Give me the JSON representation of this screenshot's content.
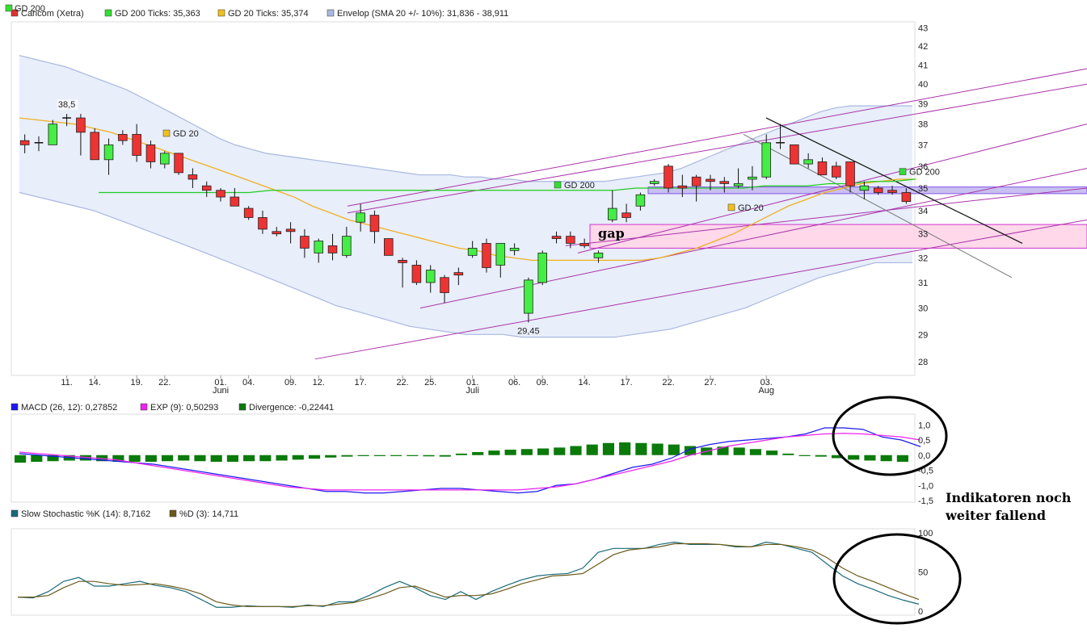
{
  "chart_data": [
    {
      "type": "candlestick",
      "legend": [
        {
          "label": "Cancom (Xetra)",
          "color": "#e03030"
        },
        {
          "label": "GD 200 Ticks: 35,363",
          "color": "#33dd33"
        },
        {
          "label": "GD 20 Ticks: 35,374",
          "color": "#f0c020"
        },
        {
          "label": "Envelop (SMA 20 +/- 10%): 31,836 - 38,911",
          "color": "#a8b8e0"
        }
      ],
      "legend_overlap_label": "GD 200",
      "y_ticks": [
        28,
        29,
        30,
        31,
        32,
        33,
        34,
        35,
        36,
        37,
        38,
        39,
        40,
        41,
        42,
        43
      ],
      "ylim": [
        27.6,
        43.2
      ],
      "y_scale": "log",
      "x_ticks": [
        "11.",
        "14.",
        "19.",
        "22.",
        "01.",
        "04.",
        "09.",
        "12.",
        "17.",
        "22.",
        "25.",
        "01.",
        "06.",
        "09.",
        "14.",
        "17.",
        "22.",
        "27.",
        "03."
      ],
      "x_tick_index": [
        3,
        5,
        8,
        10,
        14,
        16,
        19,
        21,
        24,
        27,
        29,
        32,
        35,
        37,
        40,
        43,
        46,
        49,
        53
      ],
      "month_labels": [
        {
          "text": "Juni",
          "index": 14
        },
        {
          "text": "Juli",
          "index": 32
        },
        {
          "text": "Aug",
          "index": 53
        }
      ],
      "candles": [
        {
          "o": 37.2,
          "h": 37.5,
          "l": 36.6,
          "c": 37.0
        },
        {
          "o": 37.1,
          "h": 37.4,
          "l": 36.7,
          "c": 37.1
        },
        {
          "o": 37.0,
          "h": 38.2,
          "l": 37.0,
          "c": 38.0
        },
        {
          "o": 38.3,
          "h": 38.5,
          "l": 37.9,
          "c": 38.3
        },
        {
          "o": 38.3,
          "h": 38.5,
          "l": 36.5,
          "c": 37.6
        },
        {
          "o": 37.6,
          "h": 37.8,
          "l": 36.3,
          "c": 36.3
        },
        {
          "o": 36.3,
          "h": 37.3,
          "l": 35.6,
          "c": 37.0
        },
        {
          "o": 37.5,
          "h": 37.7,
          "l": 37.0,
          "c": 37.2
        },
        {
          "o": 37.5,
          "h": 38.0,
          "l": 36.2,
          "c": 36.5
        },
        {
          "o": 37.0,
          "h": 37.2,
          "l": 35.9,
          "c": 36.2
        },
        {
          "o": 36.1,
          "h": 36.7,
          "l": 35.9,
          "c": 36.6
        },
        {
          "o": 36.6,
          "h": 36.6,
          "l": 35.6,
          "c": 35.7
        },
        {
          "o": 35.6,
          "h": 35.9,
          "l": 35.0,
          "c": 35.4
        },
        {
          "o": 35.1,
          "h": 35.3,
          "l": 34.6,
          "c": 34.9
        },
        {
          "o": 34.9,
          "h": 35.0,
          "l": 34.4,
          "c": 34.6
        },
        {
          "o": 34.6,
          "h": 35.0,
          "l": 34.2,
          "c": 34.2
        },
        {
          "o": 34.1,
          "h": 34.2,
          "l": 33.6,
          "c": 33.7
        },
        {
          "o": 33.7,
          "h": 34.0,
          "l": 33.0,
          "c": 33.2
        },
        {
          "o": 33.1,
          "h": 33.3,
          "l": 32.9,
          "c": 33.0
        },
        {
          "o": 33.2,
          "h": 33.5,
          "l": 32.6,
          "c": 33.1
        },
        {
          "o": 32.9,
          "h": 33.2,
          "l": 32.0,
          "c": 32.4
        },
        {
          "o": 32.2,
          "h": 32.8,
          "l": 31.8,
          "c": 32.7
        },
        {
          "o": 32.5,
          "h": 33.0,
          "l": 31.9,
          "c": 32.2
        },
        {
          "o": 32.1,
          "h": 33.3,
          "l": 32.0,
          "c": 32.9
        },
        {
          "o": 33.5,
          "h": 34.3,
          "l": 33.1,
          "c": 33.9
        },
        {
          "o": 33.8,
          "h": 34.0,
          "l": 32.6,
          "c": 33.1
        },
        {
          "o": 32.8,
          "h": 32.8,
          "l": 32.1,
          "c": 32.1
        },
        {
          "o": 31.9,
          "h": 32.0,
          "l": 30.8,
          "c": 31.8
        },
        {
          "o": 31.7,
          "h": 31.9,
          "l": 30.9,
          "c": 31.0
        },
        {
          "o": 31.0,
          "h": 31.7,
          "l": 30.6,
          "c": 31.5
        },
        {
          "o": 31.2,
          "h": 31.3,
          "l": 30.2,
          "c": 30.6
        },
        {
          "o": 31.4,
          "h": 31.6,
          "l": 30.9,
          "c": 31.3
        },
        {
          "o": 32.1,
          "h": 32.7,
          "l": 32.0,
          "c": 32.4
        },
        {
          "o": 32.6,
          "h": 32.8,
          "l": 31.4,
          "c": 31.6
        },
        {
          "o": 31.7,
          "h": 32.6,
          "l": 31.2,
          "c": 32.6
        },
        {
          "o": 32.3,
          "h": 32.6,
          "l": 32.1,
          "c": 32.4
        },
        {
          "o": 29.8,
          "h": 31.2,
          "l": 29.45,
          "c": 31.1
        },
        {
          "o": 31.0,
          "h": 32.3,
          "l": 30.9,
          "c": 32.2
        },
        {
          "o": 32.9,
          "h": 33.1,
          "l": 32.6,
          "c": 32.8
        },
        {
          "o": 32.9,
          "h": 33.1,
          "l": 32.4,
          "c": 32.6
        },
        {
          "o": 32.6,
          "h": 32.8,
          "l": 32.4,
          "c": 32.5
        },
        {
          "o": 32.0,
          "h": 32.3,
          "l": 31.8,
          "c": 32.2
        },
        {
          "o": 33.6,
          "h": 34.9,
          "l": 33.5,
          "c": 34.1
        },
        {
          "o": 33.9,
          "h": 34.3,
          "l": 33.5,
          "c": 33.7
        },
        {
          "o": 34.2,
          "h": 34.8,
          "l": 34.0,
          "c": 34.7
        },
        {
          "o": 35.2,
          "h": 35.4,
          "l": 35.1,
          "c": 35.3
        },
        {
          "o": 36.0,
          "h": 36.1,
          "l": 34.8,
          "c": 35.0
        },
        {
          "o": 35.1,
          "h": 35.6,
          "l": 34.6,
          "c": 35.0
        },
        {
          "o": 35.5,
          "h": 35.6,
          "l": 34.4,
          "c": 35.1
        },
        {
          "o": 35.4,
          "h": 35.6,
          "l": 34.9,
          "c": 35.3
        },
        {
          "o": 35.3,
          "h": 35.5,
          "l": 34.8,
          "c": 35.2
        },
        {
          "o": 35.1,
          "h": 35.9,
          "l": 35.0,
          "c": 35.2
        },
        {
          "o": 35.4,
          "h": 36.0,
          "l": 34.9,
          "c": 35.5
        },
        {
          "o": 35.5,
          "h": 37.5,
          "l": 35.4,
          "c": 37.1
        },
        {
          "o": 37.1,
          "h": 38.0,
          "l": 36.8,
          "c": 37.1
        },
        {
          "o": 37.0,
          "h": 37.0,
          "l": 36.1,
          "c": 36.1
        },
        {
          "o": 36.1,
          "h": 36.6,
          "l": 35.9,
          "c": 36.3
        },
        {
          "o": 36.2,
          "h": 36.4,
          "l": 35.6,
          "c": 35.6
        },
        {
          "o": 36.0,
          "h": 36.2,
          "l": 35.4,
          "c": 35.5
        },
        {
          "o": 36.2,
          "h": 36.2,
          "l": 34.8,
          "c": 35.1
        },
        {
          "o": 34.9,
          "h": 35.3,
          "l": 34.5,
          "c": 35.1
        },
        {
          "o": 35.0,
          "h": 35.1,
          "l": 34.7,
          "c": 34.8
        },
        {
          "o": 34.9,
          "h": 35.1,
          "l": 34.7,
          "c": 34.8
        },
        {
          "o": 34.8,
          "h": 35.0,
          "l": 34.3,
          "c": 34.4
        }
      ],
      "envelope_upper": [
        41.5,
        41.3,
        41.1,
        40.9,
        40.6,
        40.3,
        40.0,
        39.7,
        39.3,
        38.9,
        38.5,
        38.1,
        37.7,
        37.3,
        37.0,
        36.8,
        36.6,
        36.5,
        36.4,
        36.3,
        36.2,
        36.1,
        36.0,
        35.9,
        35.8,
        35.7,
        35.6,
        35.6,
        35.6,
        35.5,
        35.5,
        35.4,
        35.4,
        35.3,
        35.3,
        35.3,
        35.3,
        35.3,
        35.3,
        35.4,
        35.5,
        35.6,
        35.7,
        35.9,
        36.2,
        36.5,
        36.8,
        37.1,
        37.4,
        37.7,
        38.0,
        38.3,
        38.6,
        38.8,
        38.9,
        38.9,
        38.9,
        38.9,
        38.9
      ],
      "envelope_lower": [
        34.8,
        34.6,
        34.4,
        34.2,
        34.0,
        33.7,
        33.4,
        33.1,
        32.8,
        32.5,
        32.2,
        31.9,
        31.6,
        31.3,
        31.0,
        30.7,
        30.4,
        30.1,
        29.9,
        29.7,
        29.5,
        29.3,
        29.2,
        29.1,
        29.0,
        29.0,
        29.0,
        28.9,
        28.9,
        28.9,
        28.9,
        28.9,
        28.9,
        29.0,
        29.1,
        29.2,
        29.4,
        29.6,
        29.8,
        30.0,
        30.3,
        30.6,
        30.9,
        31.2,
        31.4,
        31.6,
        31.8,
        31.8,
        31.8
      ],
      "gd20": [
        38.3,
        38.2,
        38.1,
        38.0,
        37.8,
        37.6,
        37.3,
        37.0,
        36.7,
        36.4,
        36.1,
        35.8,
        35.5,
        35.2,
        34.9,
        34.6,
        34.2,
        33.9,
        33.6,
        33.4,
        33.2,
        33.0,
        32.8,
        32.6,
        32.4,
        32.3,
        32.1,
        32.0,
        31.9,
        31.9,
        31.9,
        31.9,
        31.9,
        31.9,
        31.9,
        32.0,
        32.2,
        32.4,
        32.7,
        33.0,
        33.4,
        33.8,
        34.2,
        34.5,
        34.8,
        35.0,
        35.2,
        35.3,
        35.4,
        35.4
      ],
      "gd200": [
        34.8,
        34.8,
        34.8,
        34.8,
        34.8,
        34.8,
        34.8,
        34.8,
        34.9,
        34.9,
        34.9,
        34.9,
        34.9,
        34.9,
        34.9,
        34.9,
        34.9,
        34.9,
        34.9,
        34.9,
        34.9,
        34.9,
        34.9,
        34.9,
        34.9,
        35.0,
        35.0,
        35.0,
        35.0,
        35.0,
        35.0,
        35.1,
        35.1,
        35.1,
        35.2,
        35.2,
        35.3,
        35.3,
        35.4
      ],
      "point_labels": [
        {
          "text": "38,5"
        },
        {
          "text": "29,45"
        }
      ],
      "markers": [
        {
          "label": "GD 20",
          "color": "#f0c020"
        },
        {
          "label": "GD 200",
          "color": "#33dd33"
        },
        {
          "label": "GD 20",
          "color": "#f0c020"
        },
        {
          "label": "GD 200",
          "color": "#33dd33"
        }
      ],
      "gap_label": "gap"
    },
    {
      "type": "line",
      "legend": [
        {
          "label": "MACD (26, 12): 0,27852",
          "color": "#1a1aee"
        },
        {
          "label": "EXP (9): 0,50293",
          "color": "#ee22ee"
        },
        {
          "label": "Divergence: -0,22441",
          "color": "#0a7a0a"
        }
      ],
      "y_ticks": [
        "1,0",
        "0,5",
        "0,0",
        "-0,5",
        "-1,0",
        "-1,5"
      ],
      "ylim": [
        -1.5,
        1.3
      ],
      "series": [
        {
          "name": "MACD (26, 12)",
          "values": [
            0.05,
            0.0,
            -0.05,
            -0.1,
            -0.15,
            -0.2,
            -0.25,
            -0.3,
            -0.4,
            -0.5,
            -0.6,
            -0.7,
            -0.8,
            -0.9,
            -1.0,
            -1.1,
            -1.2,
            -1.2,
            -1.25,
            -1.25,
            -1.2,
            -1.15,
            -1.1,
            -1.1,
            -1.15,
            -1.2,
            -1.25,
            -1.2,
            -1.0,
            -0.95,
            -0.8,
            -0.6,
            -0.4,
            -0.3,
            -0.1,
            0.2,
            0.35,
            0.45,
            0.5,
            0.55,
            0.6,
            0.7,
            0.9,
            0.9,
            0.85,
            0.6,
            0.5,
            0.28
          ]
        },
        {
          "name": "EXP (9)",
          "values": [
            0.1,
            0.05,
            0.0,
            -0.05,
            -0.1,
            -0.15,
            -0.25,
            -0.35,
            -0.45,
            -0.55,
            -0.65,
            -0.75,
            -0.85,
            -0.95,
            -1.05,
            -1.1,
            -1.15,
            -1.15,
            -1.15,
            -1.15,
            -1.15,
            -1.15,
            -1.15,
            -1.15,
            -1.15,
            -1.15,
            -1.15,
            -1.1,
            -1.05,
            -0.95,
            -0.8,
            -0.65,
            -0.5,
            -0.35,
            -0.2,
            0.0,
            0.15,
            0.3,
            0.4,
            0.5,
            0.6,
            0.65,
            0.7,
            0.72,
            0.7,
            0.65,
            0.6,
            0.5
          ]
        },
        {
          "name": "Divergence",
          "values": [
            -0.25,
            -0.22,
            -0.2,
            -0.18,
            -0.18,
            -0.2,
            -0.22,
            -0.22,
            -0.22,
            -0.2,
            -0.18,
            -0.2,
            -0.22,
            -0.22,
            -0.2,
            -0.2,
            -0.18,
            -0.15,
            -0.12,
            -0.08,
            -0.05,
            -0.02,
            0.0,
            0.0,
            -0.02,
            -0.04,
            -0.05,
            0.05,
            0.1,
            0.15,
            0.18,
            0.2,
            0.22,
            0.25,
            0.3,
            0.35,
            0.4,
            0.42,
            0.4,
            0.38,
            0.35,
            0.3,
            0.25,
            0.28,
            0.25,
            0.2,
            0.15,
            0.05,
            -0.02,
            -0.05,
            -0.1,
            -0.15,
            -0.18,
            -0.2,
            -0.22
          ]
        }
      ],
      "annotation": "Indikatoren noch weiter fallend"
    },
    {
      "type": "line",
      "legend": [
        {
          "label": "Slow Stochastic %K (14): 8,7162",
          "color": "#1a6b7a"
        },
        {
          "label": "%D (3): 14,711",
          "color": "#6b5a1a"
        }
      ],
      "y_ticks": [
        "100",
        "50",
        "0"
      ],
      "ylim": [
        -5,
        105
      ],
      "series": [
        {
          "name": "Slow Stochastic %K (14)",
          "values": [
            18,
            17,
            25,
            38,
            43,
            32,
            32,
            35,
            38,
            33,
            30,
            25,
            15,
            5,
            5,
            7,
            6,
            6,
            5,
            8,
            6,
            12,
            12,
            20,
            30,
            38,
            30,
            20,
            15,
            25,
            15,
            25,
            33,
            40,
            45,
            47,
            48,
            55,
            75,
            80,
            80,
            80,
            85,
            88,
            85,
            85,
            85,
            82,
            82,
            88,
            85,
            80,
            75,
            60,
            45,
            35,
            28,
            20,
            14,
            9
          ]
        },
        {
          "name": "%D (3)",
          "values": [
            18,
            18,
            20,
            30,
            38,
            38,
            35,
            33,
            34,
            35,
            32,
            28,
            22,
            12,
            8,
            6,
            6,
            6,
            6,
            7,
            7,
            9,
            11,
            16,
            22,
            30,
            32,
            25,
            18,
            20,
            20,
            22,
            28,
            35,
            40,
            45,
            46,
            48,
            60,
            72,
            78,
            80,
            82,
            86,
            86,
            86,
            85,
            83,
            82,
            85,
            85,
            82,
            78,
            68,
            55,
            45,
            38,
            30,
            22,
            15
          ]
        }
      ]
    }
  ]
}
